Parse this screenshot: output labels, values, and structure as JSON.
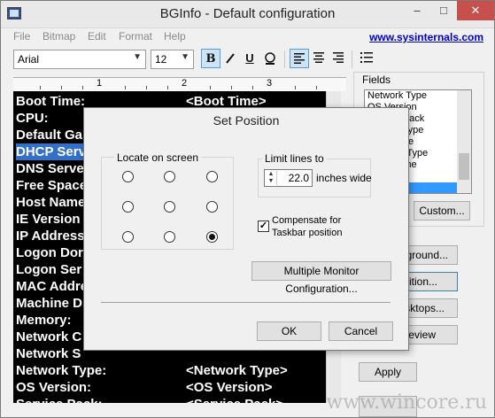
{
  "window": {
    "title": "BGInfo - Default configuration"
  },
  "menu": {
    "items": [
      "File",
      "Bitmap",
      "Edit",
      "Format",
      "Help"
    ],
    "link": "www.sysinternals.com"
  },
  "toolbar": {
    "font": "Arial",
    "size": "12",
    "bold": "B",
    "underline": "U"
  },
  "ruler": {
    "marks": [
      "1",
      "2",
      "3"
    ]
  },
  "editor": {
    "rows": [
      {
        "label": "Boot Time:",
        "value": "<Boot Time>"
      },
      {
        "label": "CPU:",
        "value": ""
      },
      {
        "label": "Default Ga",
        "value": ""
      },
      {
        "label": "DHCP Serv",
        "value": ""
      },
      {
        "label": "DNS Serve",
        "value": ""
      },
      {
        "label": "Free Space",
        "value": ""
      },
      {
        "label": "Host Name",
        "value": ""
      },
      {
        "label": "IE Version",
        "value": ""
      },
      {
        "label": "IP Address",
        "value": ""
      },
      {
        "label": "Logon Dor",
        "value": ""
      },
      {
        "label": "Logon Ser",
        "value": ""
      },
      {
        "label": "MAC Addre",
        "value": ""
      },
      {
        "label": "Machine D",
        "value": ""
      },
      {
        "label": "Memory:",
        "value": ""
      },
      {
        "label": "Network C",
        "value": ""
      },
      {
        "label": "Network S",
        "value": ""
      },
      {
        "label": "Network Type:",
        "value": "<Network Type>"
      },
      {
        "label": "OS Version:",
        "value": "<OS Version>"
      },
      {
        "label": "Service Pack:",
        "value": "<Service Pack>"
      }
    ]
  },
  "fields": {
    "label": "Fields",
    "items": [
      "Network Type",
      "OS Version",
      "Service Pack",
      "System Type",
      "Time Zone",
      "Machine Type",
      "User Name",
      "Volumes",
      ""
    ],
    "selected_index": 7,
    "custom_button": "Custom...",
    "background_button": "Background...",
    "position_button": "Position...",
    "desktops_button": "Desktops...",
    "preview_button": "Preview",
    "apply_button": "Apply"
  },
  "dialog": {
    "title": "Set Position",
    "locate_label": "Locate on screen",
    "selected_position": "bottom-right",
    "limit_label": "Limit lines to",
    "limit_value": "22.0",
    "limit_unit": "inches wide",
    "compensate_label_line1": "Compensate for",
    "compensate_label_line2": "Taskbar position",
    "compensate_checked": true,
    "multi_monitor_button": "Multiple Monitor Configuration...",
    "ok_button": "OK",
    "cancel_button": "Cancel"
  },
  "watermark": "www.wincore.ru"
}
